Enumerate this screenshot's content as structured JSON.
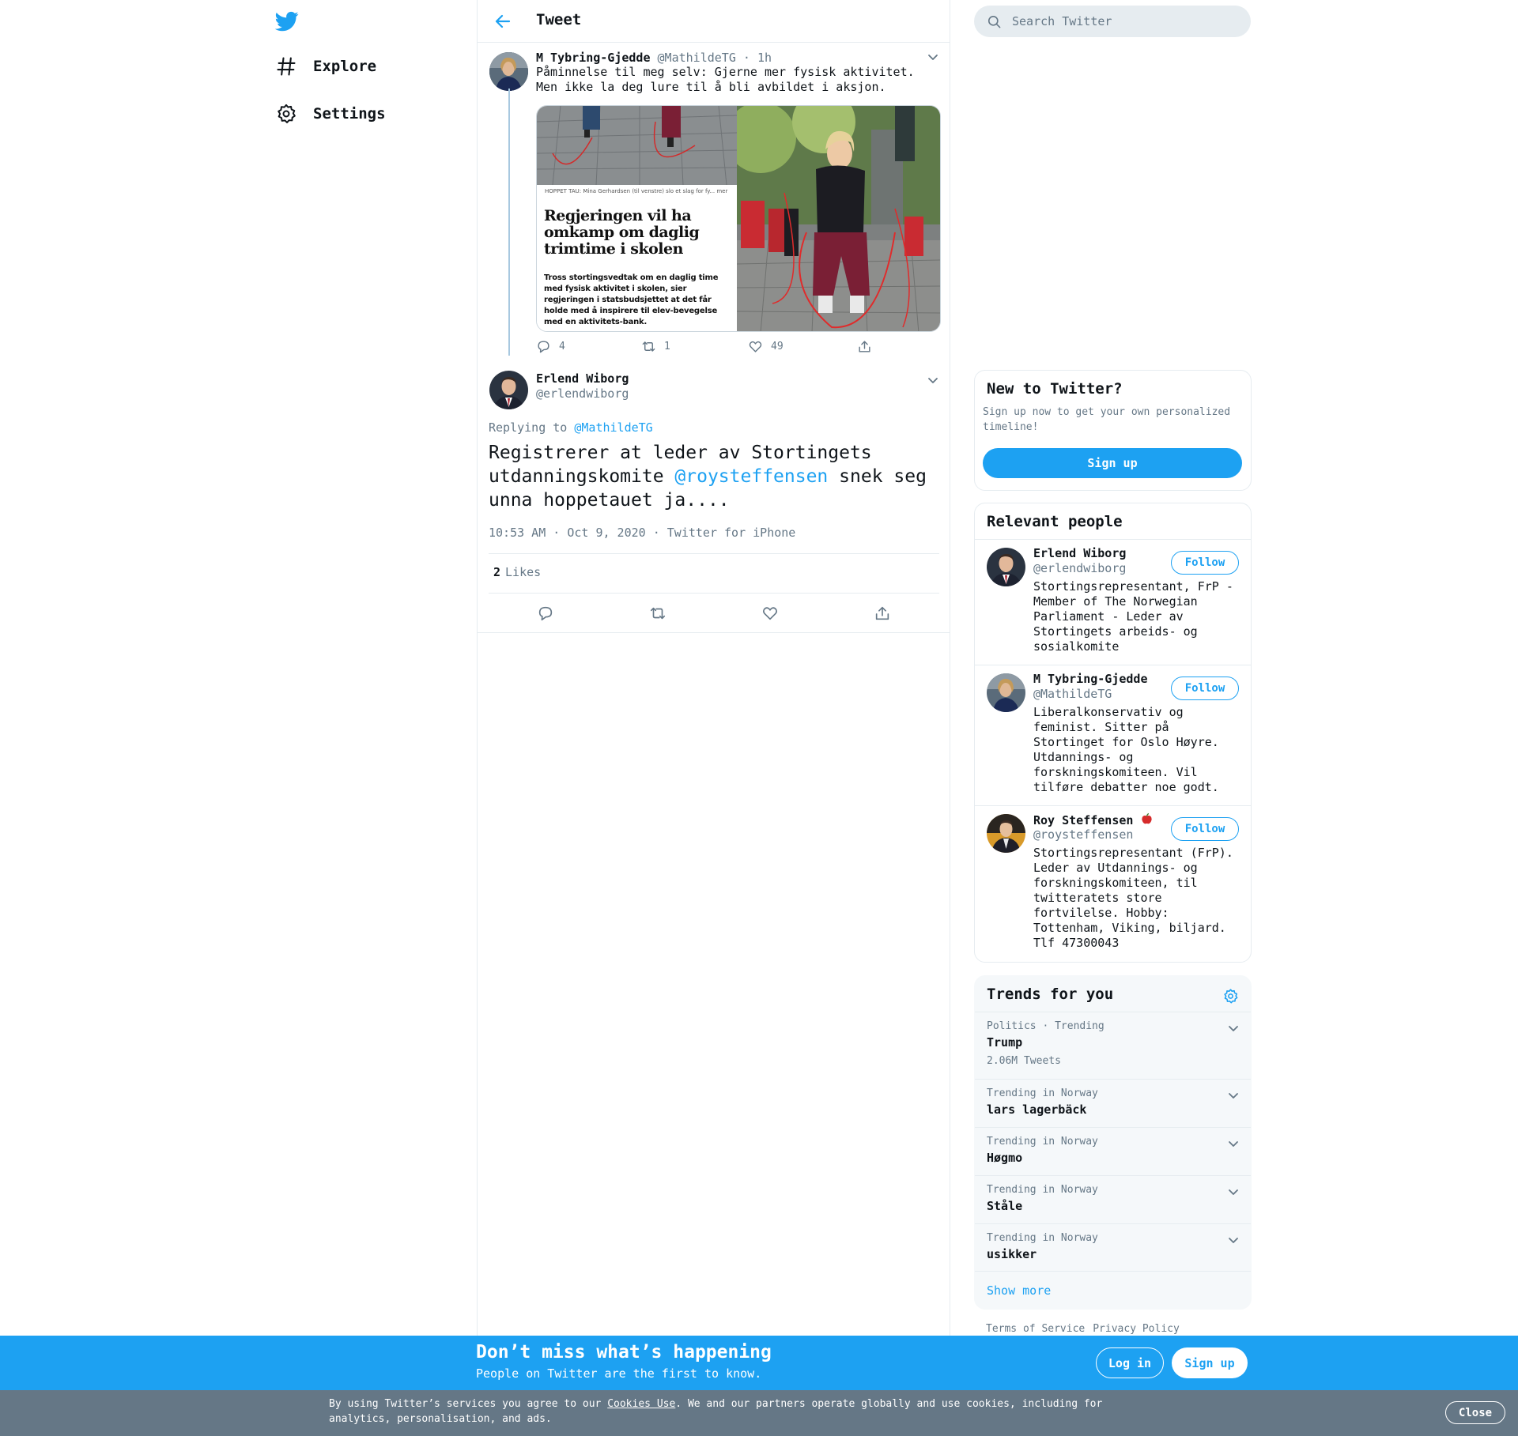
{
  "colors": {
    "accent": "#1da1f2",
    "muted": "#657786",
    "border": "#e6ecf0",
    "cookie_bar": "#657786"
  },
  "nav": {
    "logo_icon": "twitter-bird-icon",
    "items": [
      {
        "label": "Explore",
        "icon": "hashtag-icon"
      },
      {
        "label": "Settings",
        "icon": "gear-icon"
      }
    ]
  },
  "header": {
    "title": "Tweet",
    "back_icon": "back-arrow-icon"
  },
  "tweet1": {
    "name": "M Tybring-Gjedde",
    "handle": "@MathildeTG",
    "sep": "·",
    "time": "1h",
    "text": "Påminnelse til meg selv: Gjerne mer fysisk aktivitet. Men ikke la deg lure til å bli avbildet i aksjon.",
    "media": {
      "caption": "HOPPET TAU: Mina Gerhardsen (til venstre) slo et slag for fy...   mer",
      "headline": "Regjeringen vil ha omkamp om daglig trimtime i skolen",
      "lede": "Tross stortingsvedtak om en daglig time med fysisk aktivitet i skolen, sier regjeringen i statsbudsjettet at det får holde med å inspirere til elev-bevegelse med en aktivitets-bank."
    },
    "replies": "4",
    "retweets": "1",
    "likes": "49"
  },
  "tweet2": {
    "name": "Erlend Wiborg",
    "handle": "@erlendwiborg",
    "replying_prefix": "Replying to",
    "replying_to": "@MathildeTG",
    "text_before": "Registrerer at leder av Stortingets utdanningskomite",
    "mention": "@roysteffensen",
    "text_after": "snek seg unna hoppetauet ja....",
    "time": "10:53 AM · Oct 9, 2020",
    "sep": "·",
    "source": "Twitter for iPhone",
    "likes_count": "2",
    "likes_label": "Likes"
  },
  "search": {
    "placeholder": "Search Twitter"
  },
  "new_to_twitter": {
    "title": "New to Twitter?",
    "desc": "Sign up now to get your own personalized timeline!",
    "button": "Sign up"
  },
  "relevant_people": {
    "title": "Relevant people",
    "follow_label": "Follow",
    "people": [
      {
        "name": "Erlend Wiborg",
        "handle": "@erlendwiborg",
        "bio": "Stortingsrepresentant, FrP - Member of The Norwegian Parliament - Leder av Stortingets arbeids- og sosialkomite"
      },
      {
        "name": "M Tybring-Gjedde",
        "handle": "@MathildeTG",
        "bio": "Liberalkonservativ og feminist. Sitter på Stortinget for Oslo Høyre. Utdannings- og forskningskomiteen. Vil tilføre debatter noe godt."
      },
      {
        "name": "Roy Steffensen",
        "handle": "@roysteffensen",
        "bio": "Stortingsrepresentant (FrP). Leder av Utdannings- og forskningskomiteen, til twitteratets store fortvilelse. Hobby: Tottenham, Viking, biljard. Tlf 47300043"
      }
    ]
  },
  "trends": {
    "title": "Trends for you",
    "items": [
      {
        "meta": "Politics · Trending",
        "name": "Trump",
        "count": "2.06M Tweets"
      },
      {
        "meta": "Trending in Norway",
        "name": "lars lagerbäck",
        "count": ""
      },
      {
        "meta": "Trending in Norway",
        "name": "Høgmo",
        "count": ""
      },
      {
        "meta": "Trending in Norway",
        "name": "Ståle",
        "count": ""
      },
      {
        "meta": "Trending in Norway",
        "name": "usikker",
        "count": ""
      }
    ],
    "show_more": "Show more"
  },
  "footer": {
    "terms": "Terms of Service",
    "privacy": "Privacy Policy"
  },
  "bottom_bar": {
    "title": "Don’t miss what’s happening",
    "subtitle": "People on Twitter are the first to know.",
    "login": "Log in",
    "signup": "Sign up"
  },
  "cookie": {
    "prefix": "By using Twitter’s services you agree to our",
    "link": "Cookies Use",
    "suffix": ". We and our partners operate globally and use cookies, including for analytics, personalisation, and ads.",
    "close": "Close"
  }
}
